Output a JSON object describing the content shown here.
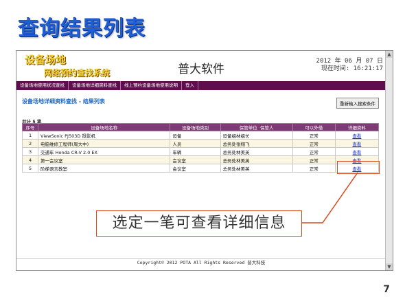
{
  "slide": {
    "title": "查询结果列表",
    "page_number": "7"
  },
  "app": {
    "logo_line1": "设备场地",
    "logo_line2": "网络预约查找系统",
    "company": "普大软件",
    "date": "2012 年 06 月 07 日",
    "time": "现在时间: 16:21:17",
    "nav": [
      "设备场地使用状况查找",
      "设备场地详细资料查找",
      "线上预约设备场地使用说明",
      "登入"
    ]
  },
  "page": {
    "section_title": "设备场地详细资料查找 - 结果列表",
    "reset_button": "重新输入搜索条件",
    "total": "共计 5 笔"
  },
  "table": {
    "headers": [
      "序号",
      "设备场地名称",
      "设备场地类别",
      "保管单位",
      "保管人",
      "可以外借",
      "详细资料"
    ],
    "rows": [
      {
        "no": "1",
        "name": "ViewSonic PJ503D 投影机",
        "type": "设备",
        "unit": "设备组林组长",
        "status": "正常",
        "detail": "查看"
      },
      {
        "no": "2",
        "name": "电脑维修工程师(周大中)",
        "type": "人员",
        "unit": "总务处张翔飞",
        "status": "正常",
        "detail": "查看"
      },
      {
        "no": "3",
        "name": "交通车 Honda CR-V 2.0 EX",
        "type": "车辆",
        "unit": "总务处林美英",
        "status": "正常",
        "detail": "查看"
      },
      {
        "no": "4",
        "name": "第一会议室",
        "type": "会议室",
        "unit": "总务处林美英",
        "status": "正常",
        "detail": "查看"
      },
      {
        "no": "5",
        "name": "阶梯语言教室",
        "type": "会议室",
        "unit": "总务处林美英",
        "status": "正常",
        "detail": "查看"
      }
    ]
  },
  "footer": "Copyright© 2012 POTA All Rights Reserved 普大科技",
  "callout": "选定一笔可查看详细信息",
  "colors": {
    "title_blue": "#1f5fd6",
    "nav_purple": "#5e0e4e",
    "header_purple": "#7e3a74",
    "callout_orange": "#d84a1c",
    "link_blue": "#1a33c8"
  }
}
